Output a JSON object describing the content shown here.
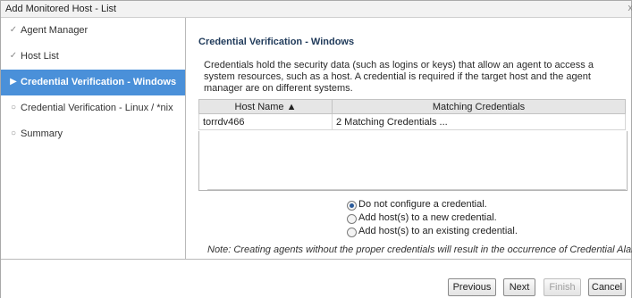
{
  "window": {
    "title": "Add Monitored Host - List",
    "close_label": "x"
  },
  "sidebar": {
    "items": [
      {
        "label": "Agent Manager",
        "icon": "check-icon",
        "glyph": "✓"
      },
      {
        "label": "Host List",
        "icon": "check-icon",
        "glyph": "✓"
      },
      {
        "label": "Credential Verification - Windows",
        "icon": "arrow-right-icon",
        "glyph": "▶"
      },
      {
        "label": "Credential Verification - Linux / *nix",
        "icon": "circle-icon",
        "glyph": "○"
      },
      {
        "label": "Summary",
        "icon": "circle-icon",
        "glyph": "○"
      }
    ]
  },
  "main": {
    "title": "Credential Verification - Windows",
    "description": "Credentials hold the security data (such as logins or keys) that allow an agent to access a system resources, such as a host. A credential is required if the target host and the agent manager are on different systems.",
    "table": {
      "headers": [
        "Host Name ▲",
        "Matching Credentials"
      ],
      "rows": [
        [
          "torrdv466",
          "2 Matching Credentials ..."
        ]
      ]
    },
    "options": [
      {
        "label": "Do not configure a credential.",
        "selected": true
      },
      {
        "label": "Add host(s) to a new credential.",
        "selected": false
      },
      {
        "label": "Add host(s) to an existing credential.",
        "selected": false
      }
    ],
    "note": "Note: Creating agents without the proper credentials will result in the occurrence of Credential Alarms."
  },
  "footer": {
    "previous": "Previous",
    "next": "Next",
    "finish": "Finish",
    "cancel": "Cancel"
  },
  "colors": {
    "active_item": "#4a90d9",
    "title_text": "#1f3a5a"
  }
}
